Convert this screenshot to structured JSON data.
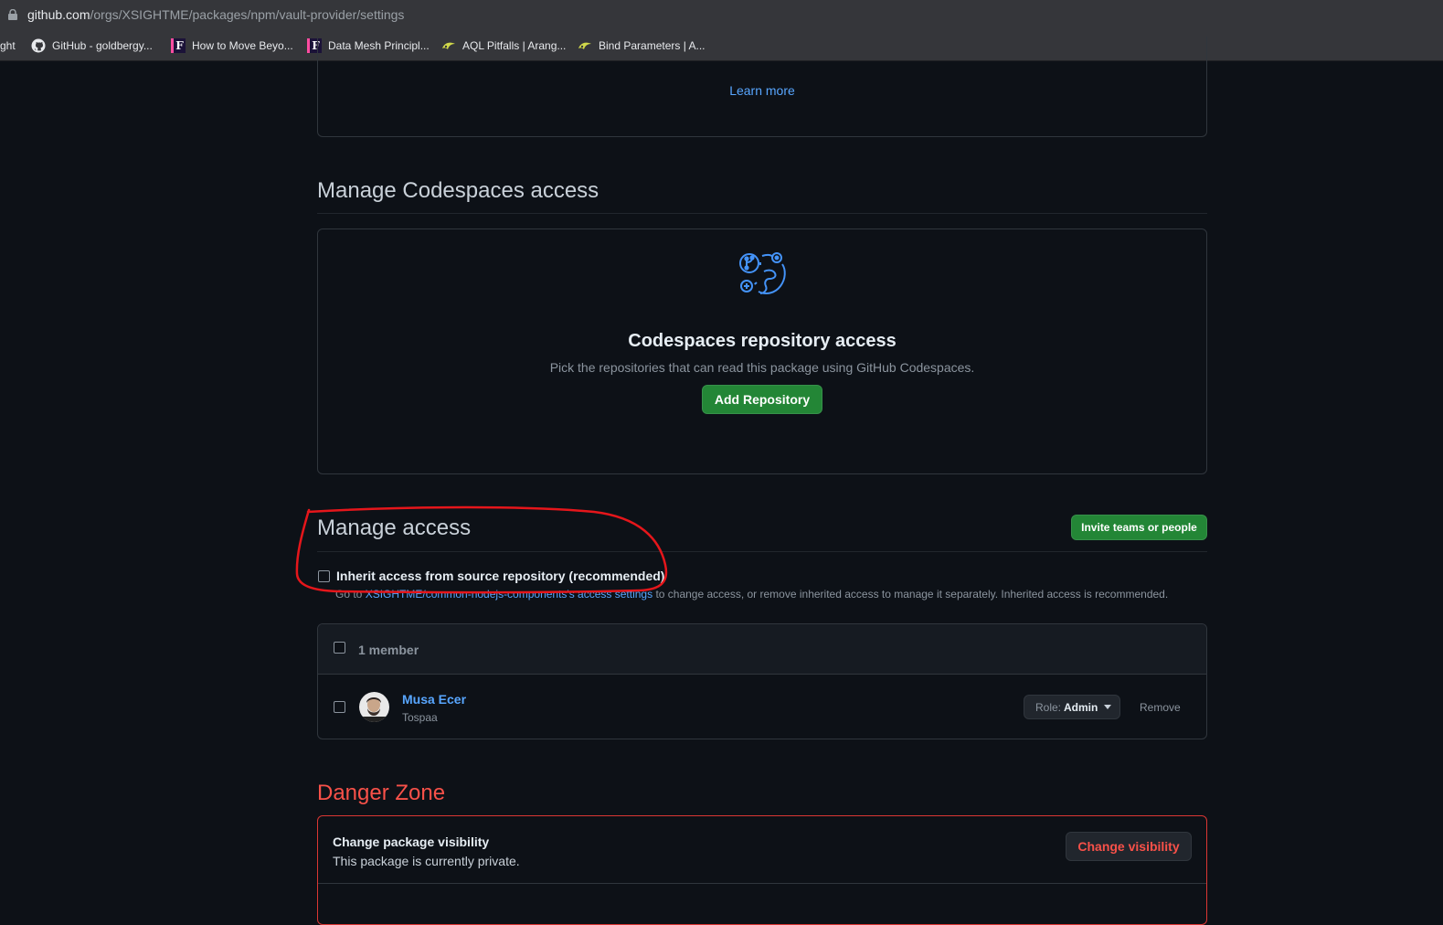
{
  "browser": {
    "url_host": "github.com",
    "url_path": "/orgs/XSIGHTME/packages/npm/vault-provider/settings",
    "bookmarks": [
      {
        "label": "ght",
        "icon": "none"
      },
      {
        "label": "GitHub - goldbergy...",
        "icon": "github-icon"
      },
      {
        "label": "How to Move Beyo...",
        "icon": "f-logo-icon"
      },
      {
        "label": "Data Mesh Principl...",
        "icon": "f-logo-icon"
      },
      {
        "label": "AQL Pitfalls | Arang...",
        "icon": "arangodb-icon"
      },
      {
        "label": "Bind Parameters | A...",
        "icon": "arangodb-icon"
      }
    ]
  },
  "top_card": {
    "learn_more": "Learn more"
  },
  "codespaces": {
    "heading": "Manage Codespaces access",
    "title": "Codespaces repository access",
    "description": "Pick the repositories that can read this package using GitHub Codespaces.",
    "add_button": "Add Repository"
  },
  "access": {
    "heading": "Manage access",
    "invite_button": "Invite teams or people",
    "inherit_label": "Inherit access from source repository (recommended)",
    "inherit_checked": false,
    "help_prefix": "Go to ",
    "help_link": "XSIGHTME/common-nodejs-components's access settings",
    "help_suffix": " to change access, or remove inherited access to manage it separately. Inherited access is recommended.",
    "members_count": "1 member",
    "members": [
      {
        "name": "Musa Ecer",
        "login": "Tospaa",
        "role_prefix": "Role: ",
        "role": "Admin",
        "remove": "Remove"
      }
    ]
  },
  "danger": {
    "heading": "Danger Zone",
    "visibility_title": "Change package visibility",
    "visibility_desc": "This package is currently private.",
    "visibility_button": "Change visibility"
  },
  "colors": {
    "background": "#0d1117",
    "border": "#30363d",
    "link": "#58a6ff",
    "green": "#238636",
    "danger": "#f85149",
    "annotation": "#e5161b"
  }
}
